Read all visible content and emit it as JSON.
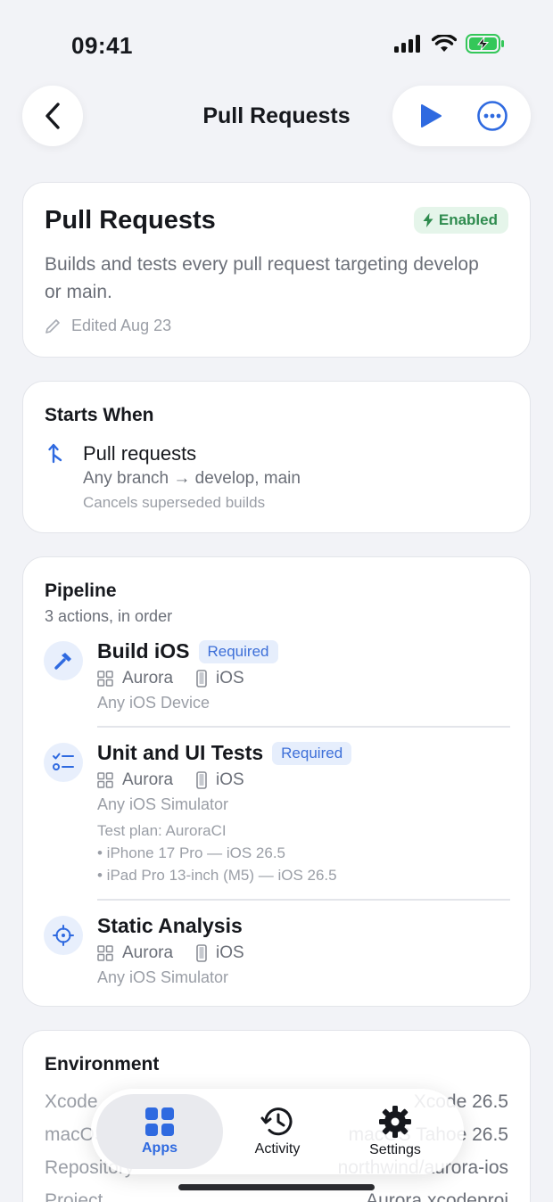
{
  "status_bar": {
    "time": "09:41"
  },
  "nav": {
    "title": "Pull Requests"
  },
  "workflow": {
    "title": "Pull Requests",
    "status": "Enabled",
    "description": "Builds and tests every pull request targeting develop or main.",
    "edited": "Edited Aug 23"
  },
  "starts_when": {
    "heading": "Starts When",
    "trigger_title": "Pull requests",
    "trigger_branches": "Any branch → develop, main",
    "trigger_note": "Cancels superseded builds"
  },
  "pipeline": {
    "heading": "Pipeline",
    "subtitle": "3 actions, in order",
    "actions": [
      {
        "title": "Build iOS",
        "badge": "Required",
        "app": "Aurora",
        "platform": "iOS",
        "target": "Any iOS Device"
      },
      {
        "title": "Unit and UI Tests",
        "badge": "Required",
        "app": "Aurora",
        "platform": "iOS",
        "target": "Any iOS Simulator",
        "test_plan": "Test plan: AuroraCI",
        "devices": [
          "• iPhone 17 Pro — iOS 26.5",
          "• iPad Pro 13-inch (M5) — iOS 26.5"
        ]
      },
      {
        "title": "Static Analysis",
        "app": "Aurora",
        "platform": "iOS",
        "target": "Any iOS Simulator"
      }
    ]
  },
  "environment": {
    "heading": "Environment",
    "rows": [
      {
        "label": "Xcode",
        "value": "Xcode 26.5"
      },
      {
        "label": "macOS",
        "value": "macOS Tahoe 26.5"
      },
      {
        "label": "Repository",
        "value": "northwind/aurora-ios"
      },
      {
        "label": "Project",
        "value": "Aurora.xcodeproj"
      }
    ]
  },
  "tabbar": {
    "apps": "Apps",
    "activity": "Activity",
    "settings": "Settings"
  },
  "colors": {
    "accent": "#2f6ae0",
    "enabled_green": "#2e8b4e",
    "background": "#f2f3f7"
  }
}
